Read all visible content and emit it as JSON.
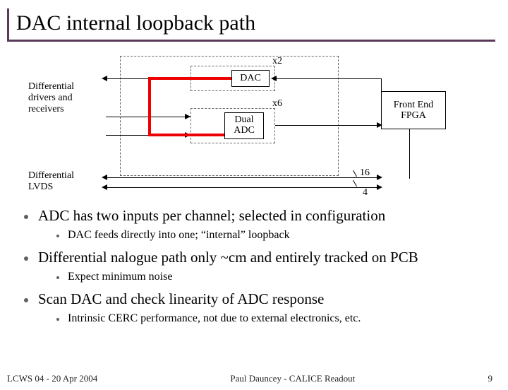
{
  "title": "DAC internal loopback path",
  "diagram": {
    "left_label": "Differential\ndrivers and\nreceivers",
    "bottom_left_label": "Differential\nLVDS",
    "dac_block": "DAC",
    "dac_mult": "x2",
    "adc_block": "Dual\nADC",
    "adc_mult": "x6",
    "fpga_block": "Front End\nFPGA",
    "bus_top": "16",
    "bus_bottom": "4"
  },
  "bullets": [
    {
      "text": "ADC has two inputs per channel; selected in configuration",
      "sub": [
        "DAC feeds directly into one; “internal” loopback"
      ]
    },
    {
      "text": "Differential nalogue path only ~cm and entirely tracked on PCB",
      "sub": [
        "Expect minimum noise"
      ]
    },
    {
      "text": "Scan DAC and check linearity of ADC response",
      "sub": [
        "Intrinsic CERC performance, not due to external electronics, etc."
      ]
    }
  ],
  "footer": {
    "left": "LCWS 04 - 20 Apr 2004",
    "center": "Paul Dauncey - CALICE Readout",
    "right": "9"
  }
}
